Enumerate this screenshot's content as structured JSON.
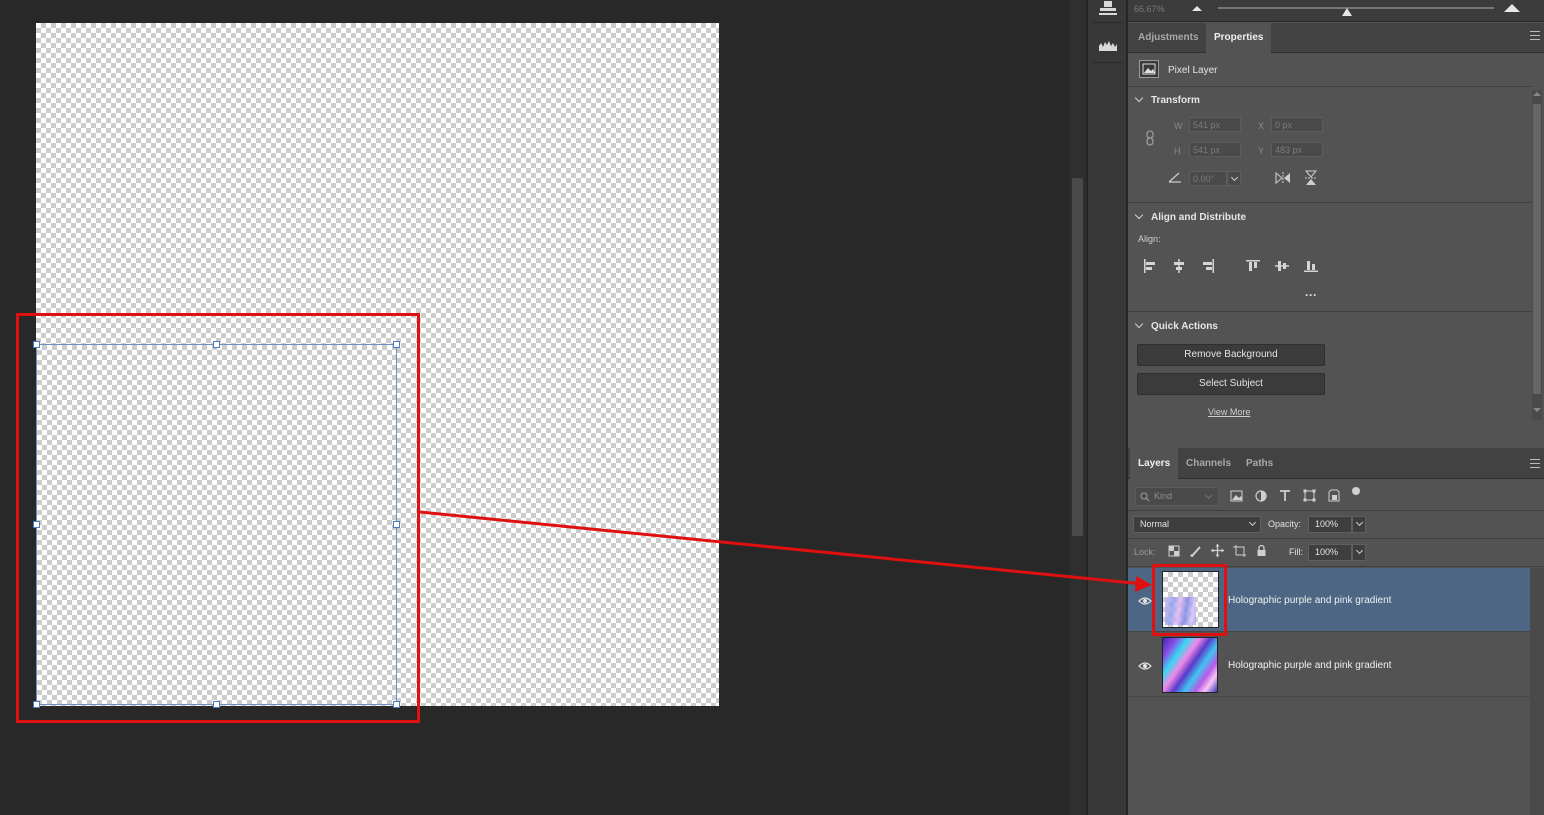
{
  "canvas": {
    "selection_color": "#6d8fc2",
    "annotation_color": "#e01010"
  },
  "toolbar": {
    "zoom_value": "66.67%"
  },
  "top_tabs": {
    "adjustments": "Adjustments",
    "properties": "Properties"
  },
  "properties": {
    "layer_type": "Pixel Layer",
    "transform": {
      "title": "Transform",
      "w_label": "W",
      "w_value": "541 px",
      "x_label": "X",
      "x_value": "0 px",
      "h_label": "H",
      "h_value": "541 px",
      "y_label": "Y",
      "y_value": "483 px",
      "angle_value": "0.00°"
    },
    "align": {
      "title": "Align and Distribute",
      "align_label": "Align:",
      "more": "···"
    },
    "quick_actions": {
      "title": "Quick Actions",
      "remove_background": "Remove Background",
      "select_subject": "Select Subject",
      "view_more": "View More"
    }
  },
  "layers_panel": {
    "tabs": {
      "layers": "Layers",
      "channels": "Channels",
      "paths": "Paths"
    },
    "filter_placeholder": "Kind",
    "blend_mode": "Normal",
    "opacity_label": "Opacity:",
    "opacity_value": "100%",
    "lock_label": "Lock:",
    "fill_label": "Fill:",
    "fill_value": "100%",
    "layers": [
      {
        "name": "Holographic purple and pink gradient",
        "selected": true
      },
      {
        "name": "Holographic purple and pink gradient",
        "selected": false
      }
    ],
    "selected_color": "#4d6683"
  }
}
